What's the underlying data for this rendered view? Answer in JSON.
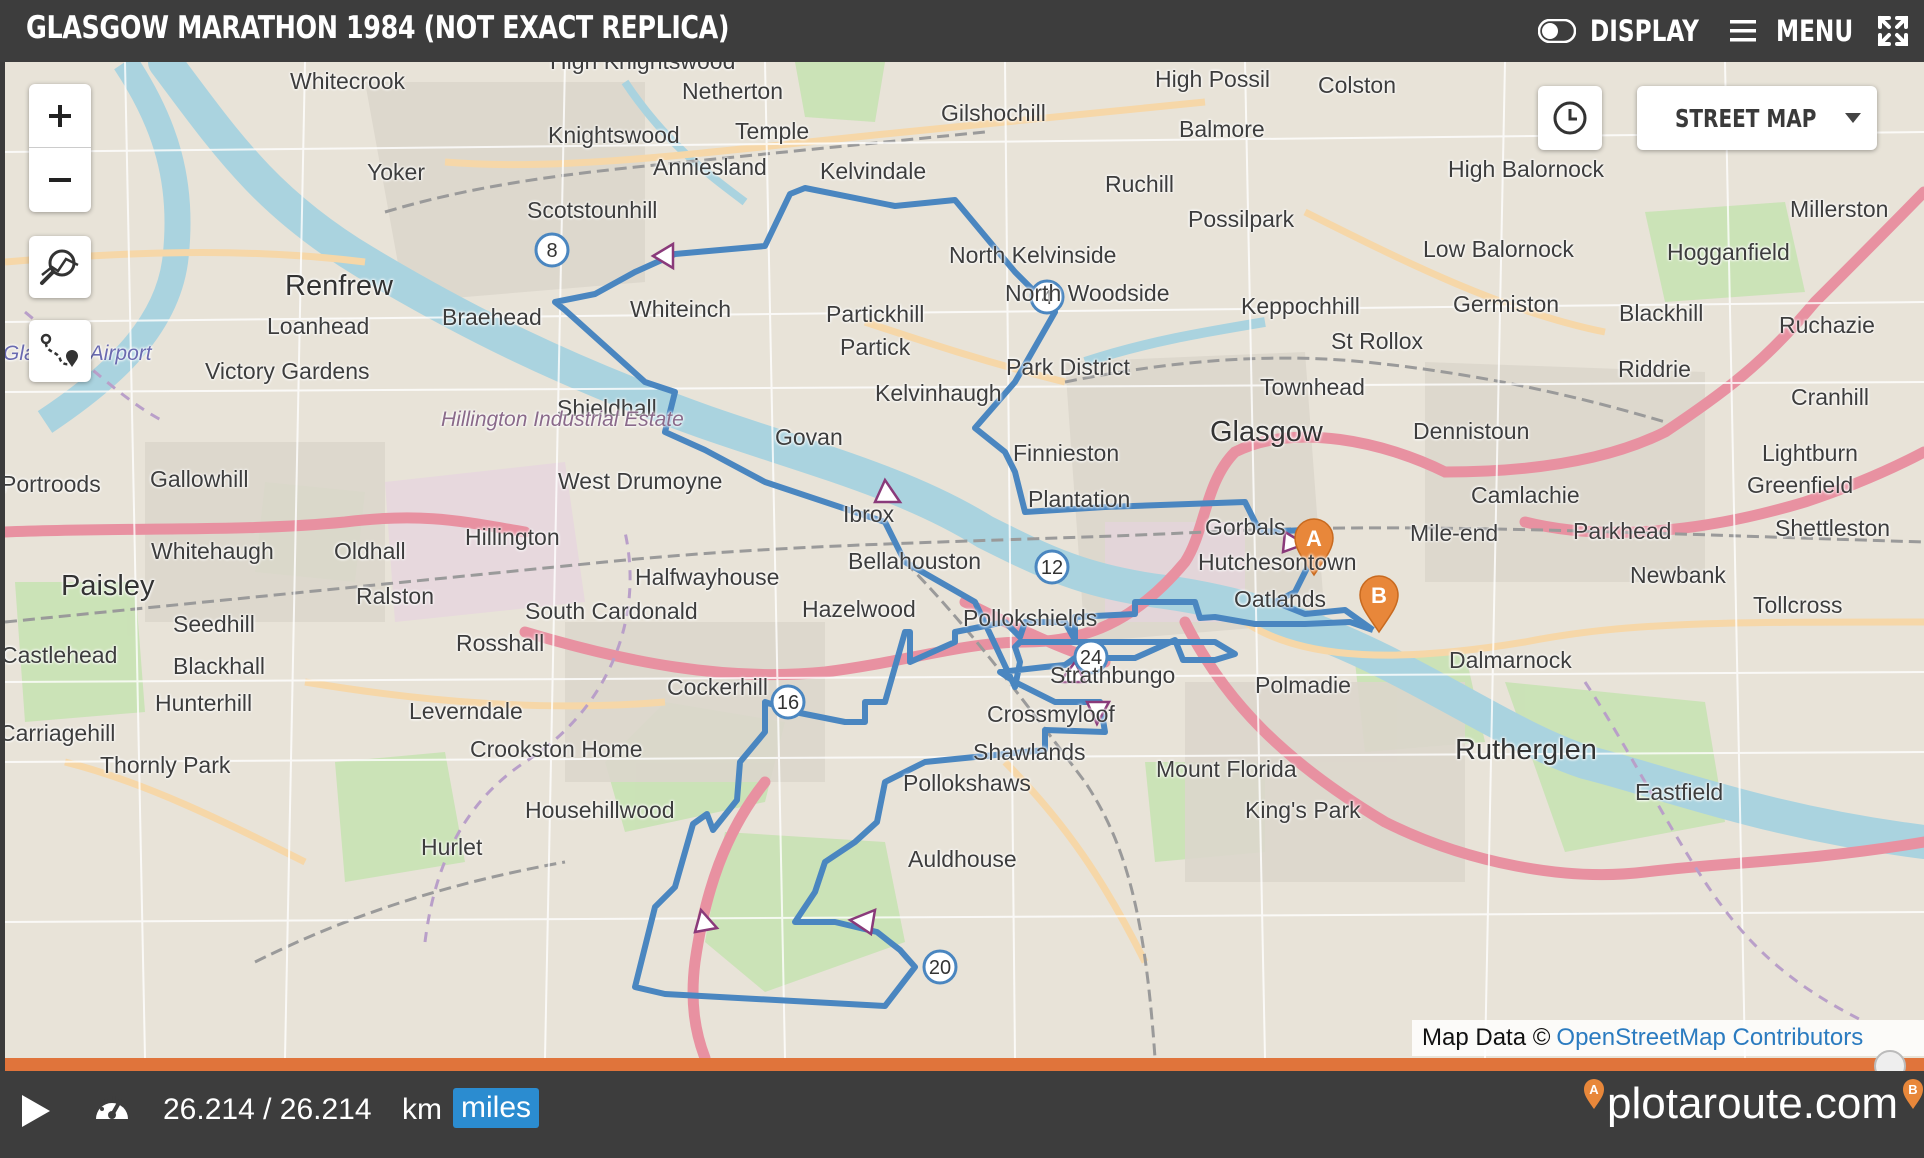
{
  "header": {
    "title": "GLASGOW MARATHON 1984 (NOT EXACT REPLICA)",
    "display_label": "DISPLAY",
    "menu_label": "MENU"
  },
  "map": {
    "layer_select": "STREET MAP",
    "attribution_prefix": "Map Data ©",
    "attribution_link": "OpenStreetMap Contributors",
    "mile_markers": [
      "4",
      "8",
      "12",
      "16",
      "20",
      "24"
    ],
    "start_marker": "A",
    "end_marker": "B",
    "places": [
      "Whitecrook",
      "Netherton",
      "High Knightswood",
      "Gilshochill",
      "High Possil",
      "Colston",
      "Knightswood",
      "Temple",
      "Anniesland",
      "Kelvindale",
      "Balmore",
      "Yoker",
      "Scotstounhill",
      "Ruchill",
      "High Balornock",
      "Millerston",
      "Possilpark",
      "North Kelvinside",
      "Low Balornock",
      "Hogganfield",
      "Renfrew",
      "Whiteinch",
      "Partickhill",
      "North Woodside",
      "Keppochhill",
      "Germiston",
      "Blackhill",
      "Ruchazie",
      "Braehead",
      "Loanhead",
      "Partick",
      "St Rollox",
      "Park District",
      "Riddrie",
      "Victory Gardens",
      "Glasgow Airport",
      "Kelvinhaugh",
      "Townhead",
      "Cranhill",
      "Shieldhall",
      "Hillington Industrial Estate",
      "Govan",
      "Glasgow",
      "Dennistoun",
      "Lightburn",
      "Finnieston",
      "Gallowhill",
      "West Drumoyne",
      "Camlachie",
      "Greenfield",
      "Portroods",
      "Plantation",
      "Ibrox",
      "Gorbals",
      "Mile-end",
      "Parkhead",
      "Shettleston",
      "Hillington",
      "Whitehaugh",
      "Oldhall",
      "Bellahouston",
      "Hutchesontown",
      "Halfwayhouse",
      "Newbank",
      "Paisley",
      "Ralston",
      "South Cardonald",
      "Hazelwood",
      "Pollokshields",
      "Oatlands",
      "Tollcross",
      "Seedhill",
      "Rosshall",
      "Castlehead",
      "Blackhall",
      "Strathbungo",
      "Dalmarnock",
      "Cockerhill",
      "Polmadie",
      "Hunterhill",
      "Leverndale",
      "Crossmyloof",
      "Carriagehill",
      "Crookston Home",
      "Shawlands",
      "Rutherglen",
      "Thornly Park",
      "Mount Florida",
      "Pollokshaws",
      "Househillwood",
      "Eastfield",
      "King's Park",
      "Hurlet",
      "Auldhouse"
    ]
  },
  "player": {
    "distance_text": "26.214 / 26.214",
    "unit_km": "km",
    "unit_miles": "miles",
    "progress_fraction": 1.0,
    "brand": "plotaroute.com"
  },
  "colors": {
    "route": "#4a86c0",
    "progress": "#e0743b",
    "bar": "#3d3d3d",
    "marker": "#e8873a"
  }
}
